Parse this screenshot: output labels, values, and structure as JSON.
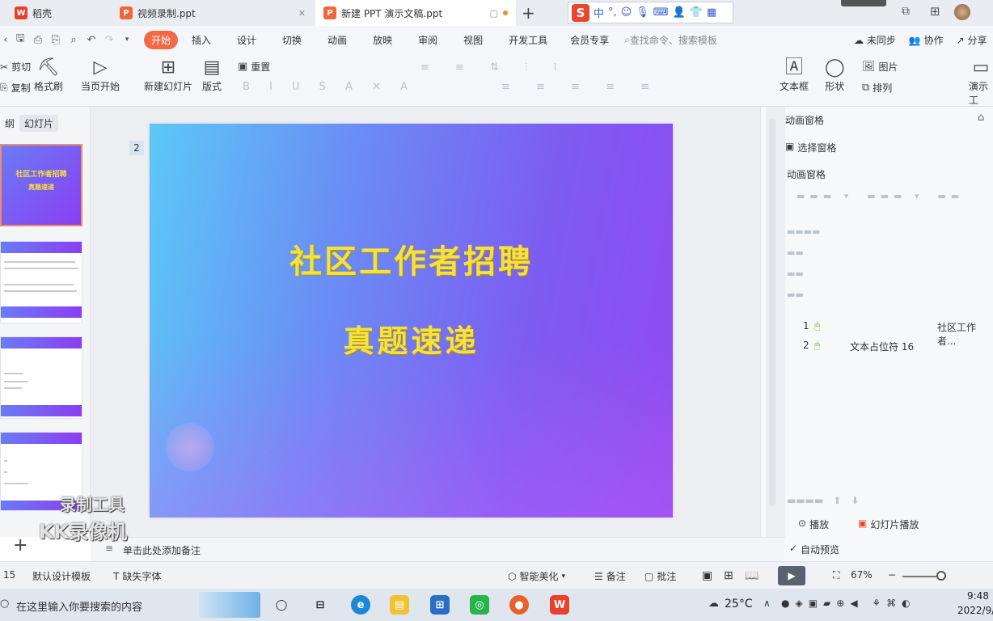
{
  "tabs": [
    {
      "label": "稻壳",
      "icon": "wps-logo-icon",
      "color": "#e8412c"
    },
    {
      "label": "视频录制.ppt",
      "icon": "ppt-file-icon",
      "color": "#f0663a"
    },
    {
      "label": "新建 PPT 演示文稿.ppt",
      "icon": "ppt-file-icon",
      "color": "#f0663a",
      "active": true
    }
  ],
  "new_tab": "+",
  "ime": {
    "lang": "中",
    "punct": "°,"
  },
  "menu": {
    "items": [
      "开始",
      "插入",
      "设计",
      "切换",
      "动画",
      "放映",
      "审阅",
      "视图",
      "开发工具",
      "会员专享"
    ],
    "active": "开始",
    "search": "查找命令、搜索模板",
    "sync": "未同步",
    "collab": "协作",
    "share": "分享"
  },
  "ribbon": {
    "cut": "剪切",
    "copy": "复制",
    "format_painter": "格式刷",
    "from_current": "当页开始",
    "new_slide": "新建幻灯片",
    "layout": "版式",
    "reset": "重置",
    "textbox": "文本框",
    "shape": "形状",
    "picture": "图片",
    "arrange": "排列",
    "presenter": "演示工"
  },
  "left_panel": {
    "tab_outline": "纲",
    "tab_slides": "幻灯片",
    "thumb1_line1": "社区工作者招聘",
    "thumb1_line2": "真题速递"
  },
  "slide": {
    "title": "社区工作者招聘",
    "subtitle": "真题速递",
    "placeholder_nums": [
      "2",
      "1"
    ]
  },
  "anim_pane": {
    "header": "动画窗格",
    "select_pane": "选择窗格",
    "section": "动画窗格",
    "items": [
      {
        "num": "1",
        "label": "社区工作者..."
      },
      {
        "num": "2",
        "label": "文本占位符 16"
      }
    ],
    "play": "播放",
    "slideshow": "幻灯片播放",
    "autopreview": "自动预览"
  },
  "notes": {
    "placeholder": "单击此处添加备注"
  },
  "status": {
    "slide_count": "15",
    "template": "默认设计模板",
    "missing_font": "缺失字体",
    "smart_beauty": "智能美化",
    "notes": "备注",
    "comment": "批注",
    "zoom": "67%"
  },
  "taskbar": {
    "search": "在这里输入你要搜索的内容",
    "temp": "25°C",
    "time": "9:48",
    "date": "2022/9/"
  },
  "watermark": {
    "line1": "录制工具",
    "line2": "KK录像机"
  }
}
